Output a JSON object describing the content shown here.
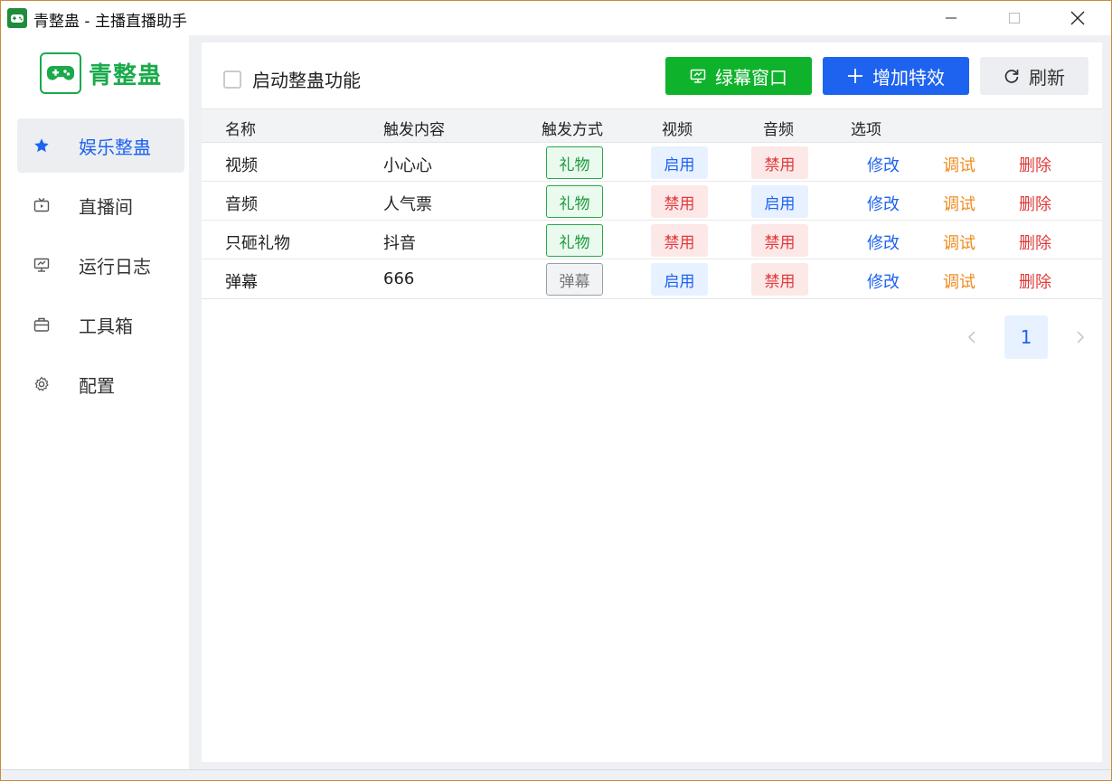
{
  "window": {
    "title": "青整蛊 - 主播直播助手"
  },
  "sidebar": {
    "logo_text": "青整蛊",
    "items": [
      {
        "label": "娱乐整蛊",
        "icon": "star-icon",
        "active": true
      },
      {
        "label": "直播间",
        "icon": "tv-icon",
        "active": false
      },
      {
        "label": "运行日志",
        "icon": "monitor-icon",
        "active": false
      },
      {
        "label": "工具箱",
        "icon": "toolbox-icon",
        "active": false
      },
      {
        "label": "配置",
        "icon": "gear-icon",
        "active": false
      }
    ]
  },
  "toolbar": {
    "enable_label": "启动整蛊功能",
    "greenscreen_label": "绿幕窗口",
    "add_effect_label": "增加特效",
    "refresh_label": "刷新"
  },
  "table": {
    "headers": [
      "名称",
      "触发内容",
      "触发方式",
      "视频",
      "音频",
      "选项"
    ],
    "rows": [
      {
        "name": "视频",
        "content": "小心心",
        "trigger": "礼物",
        "video": "启用",
        "audio": "禁用",
        "edit": "修改",
        "debug": "调试",
        "delete": "删除"
      },
      {
        "name": "音频",
        "content": "人气票",
        "trigger": "礼物",
        "video": "禁用",
        "audio": "启用",
        "edit": "修改",
        "debug": "调试",
        "delete": "删除"
      },
      {
        "name": "只砸礼物",
        "content": "抖音",
        "trigger": "礼物",
        "video": "禁用",
        "audio": "禁用",
        "edit": "修改",
        "debug": "调试",
        "delete": "删除"
      },
      {
        "name": "弹幕",
        "content": "666",
        "trigger": "弹幕",
        "video": "启用",
        "audio": "禁用",
        "edit": "修改",
        "debug": "调试",
        "delete": "删除"
      }
    ]
  },
  "pagination": {
    "current_page": "1"
  },
  "colors": {
    "brand_green": "#1aaa4b",
    "accent_blue": "#1e63f0",
    "danger_red": "#e03a3a",
    "warning_orange": "#ef8a1c"
  }
}
